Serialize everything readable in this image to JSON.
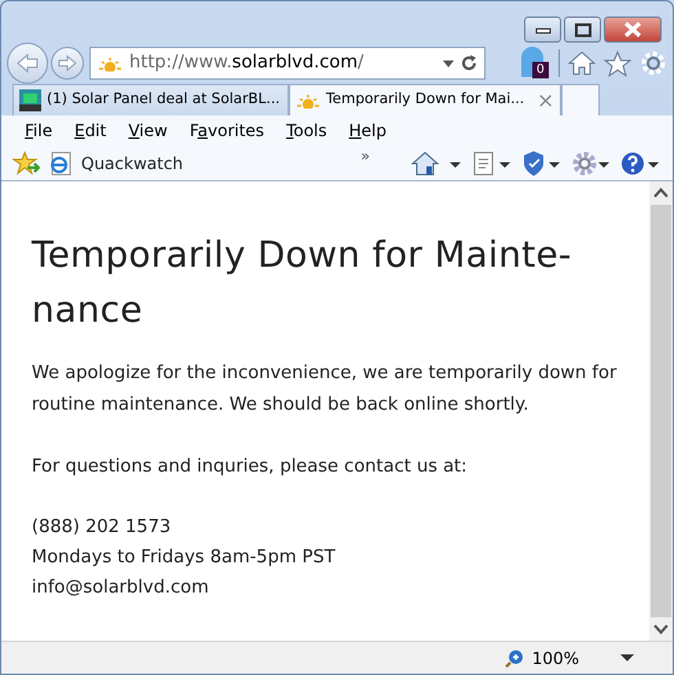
{
  "address_bar": {
    "url_prefix": "http://www.",
    "url_domain": "solarblvd.com",
    "url_suffix": "/"
  },
  "notification_badge": {
    "count": "0"
  },
  "tabs": [
    {
      "title": "(1) Solar Panel deal at SolarBL...",
      "selected": false,
      "kind": "social"
    },
    {
      "title": "Temporarily Down for Mai...",
      "selected": true,
      "kind": "sun",
      "close": "×"
    }
  ],
  "menu": [
    {
      "key": "F",
      "after": "ile"
    },
    {
      "key": "E",
      "after": "dit"
    },
    {
      "key": "V",
      "after": "iew"
    },
    {
      "before": "F",
      "key": "a",
      "after": "vorites"
    },
    {
      "key": "T",
      "after": "ools"
    },
    {
      "key": "H",
      "after": "elp"
    }
  ],
  "favorites_bar": {
    "link": "Quackwatch",
    "overflow": "»"
  },
  "page": {
    "heading": "Temporarily Down for Mainte-nance",
    "paragraphs": [
      "We apologize for the inconvenience, we are temporarily down for routine maintenance. We should be back online shortly.",
      "For questions and inquries, please contact us at:"
    ],
    "contact": [
      "(888) 202 1573",
      "Mondays to Fridays 8am-5pm PST",
      "info@solarblvd.com"
    ]
  },
  "status_bar": {
    "zoom": "100%"
  }
}
